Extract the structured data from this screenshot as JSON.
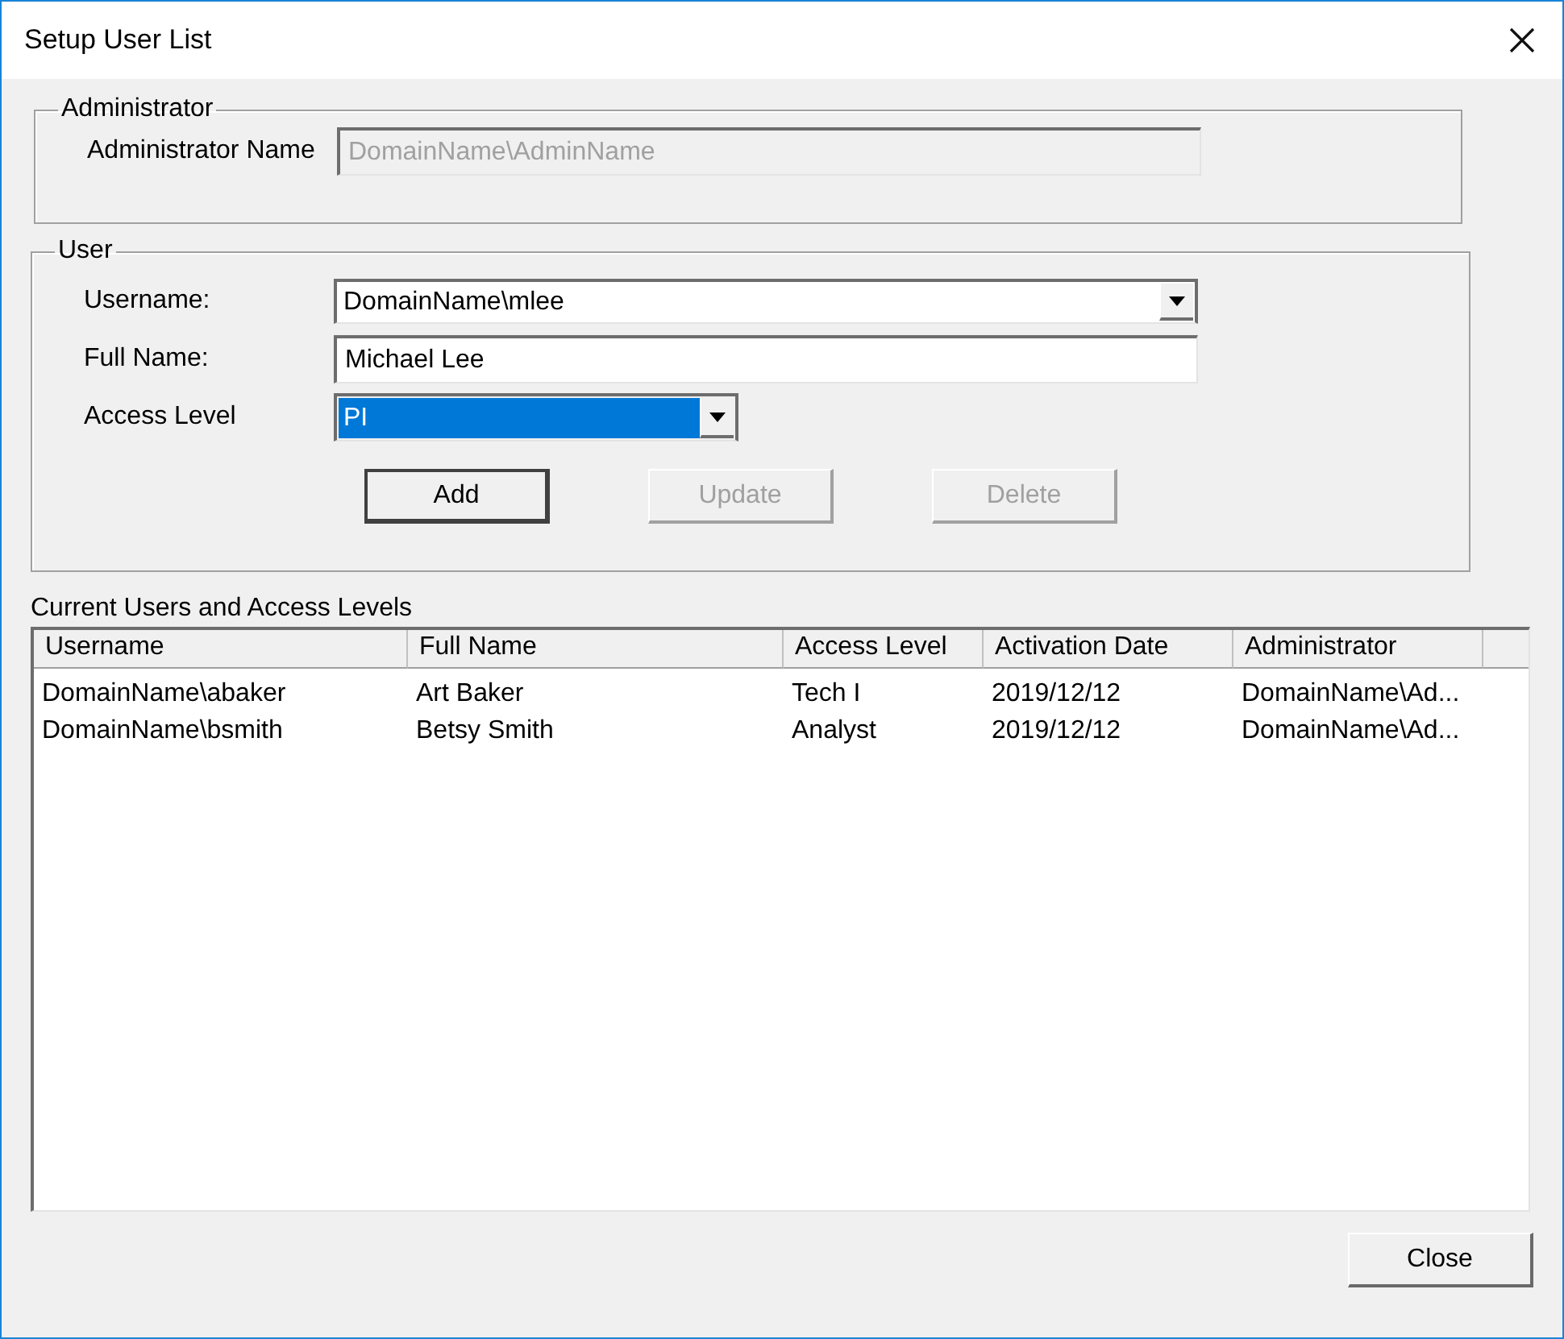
{
  "window": {
    "title": "Setup User List"
  },
  "administrator": {
    "legend": "Administrator",
    "label": "Administrator Name",
    "value": "DomainName\\AdminName",
    "disabled": true
  },
  "user": {
    "legend": "User",
    "fields": [
      {
        "kind": "combo",
        "label": "Username:",
        "value": "DomainName\\mlee",
        "highlighted": false
      },
      {
        "kind": "text",
        "label": "Full Name:",
        "value": "Michael Lee",
        "highlighted": false
      },
      {
        "kind": "combo",
        "label": "Access Level",
        "value": "PI",
        "highlighted": true
      }
    ],
    "buttons": [
      {
        "label": "Add",
        "disabled": false,
        "default": true
      },
      {
        "label": "Update",
        "disabled": true,
        "default": false
      },
      {
        "label": "Delete",
        "disabled": true,
        "default": false
      }
    ]
  },
  "users_list": {
    "title": "Current Users and Access Levels",
    "columns": [
      "Username",
      "Full Name",
      "Access Level",
      "Activation Date",
      "Administrator"
    ],
    "rows": [
      [
        "DomainName\\abaker",
        "Art Baker",
        "Tech I",
        "2019/12/12",
        "DomainName\\Ad..."
      ],
      [
        "DomainName\\bsmith",
        "Betsy Smith",
        "Analyst",
        "2019/12/12",
        "DomainName\\Ad..."
      ]
    ]
  },
  "footer_buttons": [
    {
      "label": "Close",
      "disabled": false
    }
  ]
}
